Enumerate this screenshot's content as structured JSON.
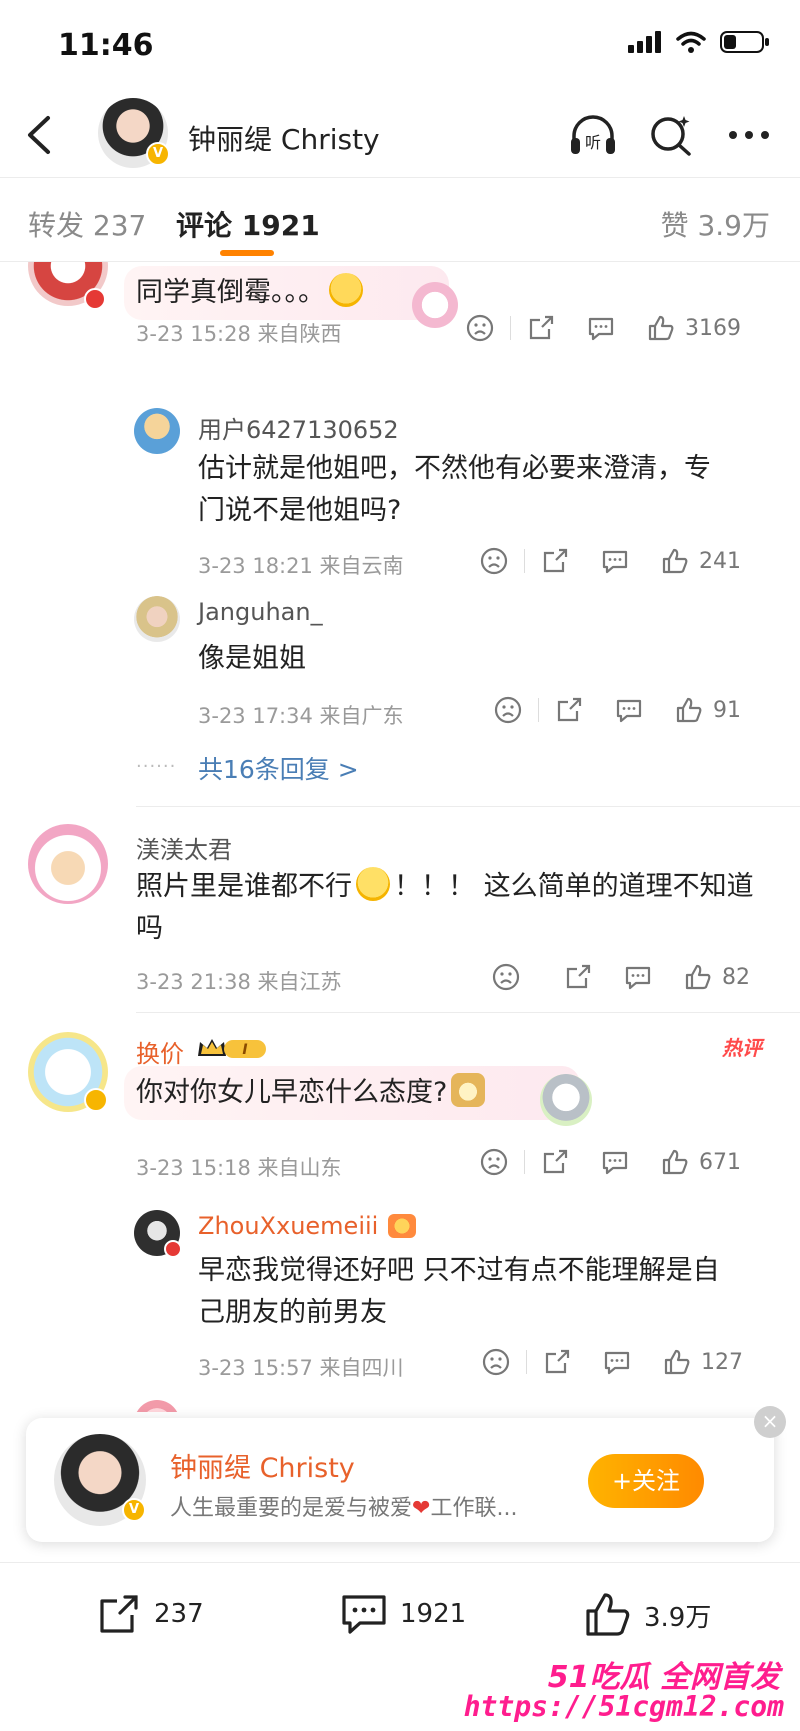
{
  "status_bar": {
    "time": "11:46"
  },
  "nav": {
    "title": "钟丽缇 Christy"
  },
  "tabs": {
    "repost": "转发 237",
    "comments": "评论 1921",
    "likes": "赞 3.9万"
  },
  "comments": [
    {
      "text": "同学真倒霉。。。",
      "meta": "3-23 15:28 来自陕西",
      "likes": "3169",
      "replies": [
        {
          "name": "用户6427130652",
          "text_line1": "估计就是他姐吧，不然他有必要来澄清，专",
          "text_line2": "门说不是他姐吗?",
          "meta": "3-23 18:21 来自云南",
          "likes": "241"
        },
        {
          "name": "Janguhan_",
          "text": "像是姐姐",
          "meta": "3-23 17:34 来自广东",
          "likes": "91"
        }
      ],
      "more_replies": "共16条回复 >"
    },
    {
      "name": "渼渼太君",
      "text_part1": "照片里是谁都不行",
      "text_part2": "！！！ 这么简单的道理不知道",
      "text_line2": "吗",
      "meta": "3-23 21:38 来自江苏",
      "likes": "82"
    },
    {
      "name": "换价",
      "hot": "热评",
      "text": "你对你女儿早恋什么态度?",
      "meta": "3-23 15:18 来自山东",
      "likes": "671",
      "replies": [
        {
          "name": "ZhouXxuemeiii",
          "text_line1": "早恋我觉得还好吧 只不过有点不能理解是自",
          "text_line2": "己朋友的前男友",
          "meta": "3-23 15:57 来自四川",
          "likes": "127"
        }
      ]
    }
  ],
  "follow_card": {
    "name": "钟丽缇 Christy",
    "bio_part1": "人生最重要的是爱与被爱",
    "bio_part2": "工作联...",
    "follow_label": "+关注",
    "close": "×"
  },
  "bottom_bar": {
    "repost": "237",
    "comment": "1921",
    "like": "3.9万"
  },
  "watermark": {
    "top": "51吃瓜 全网首发",
    "url": "https://51cgm12.com"
  },
  "colors": {
    "accent": "#ff8200",
    "link": "#4a7eb5",
    "vip_name": "#e8612b",
    "watermark": "#ff1d8e"
  }
}
